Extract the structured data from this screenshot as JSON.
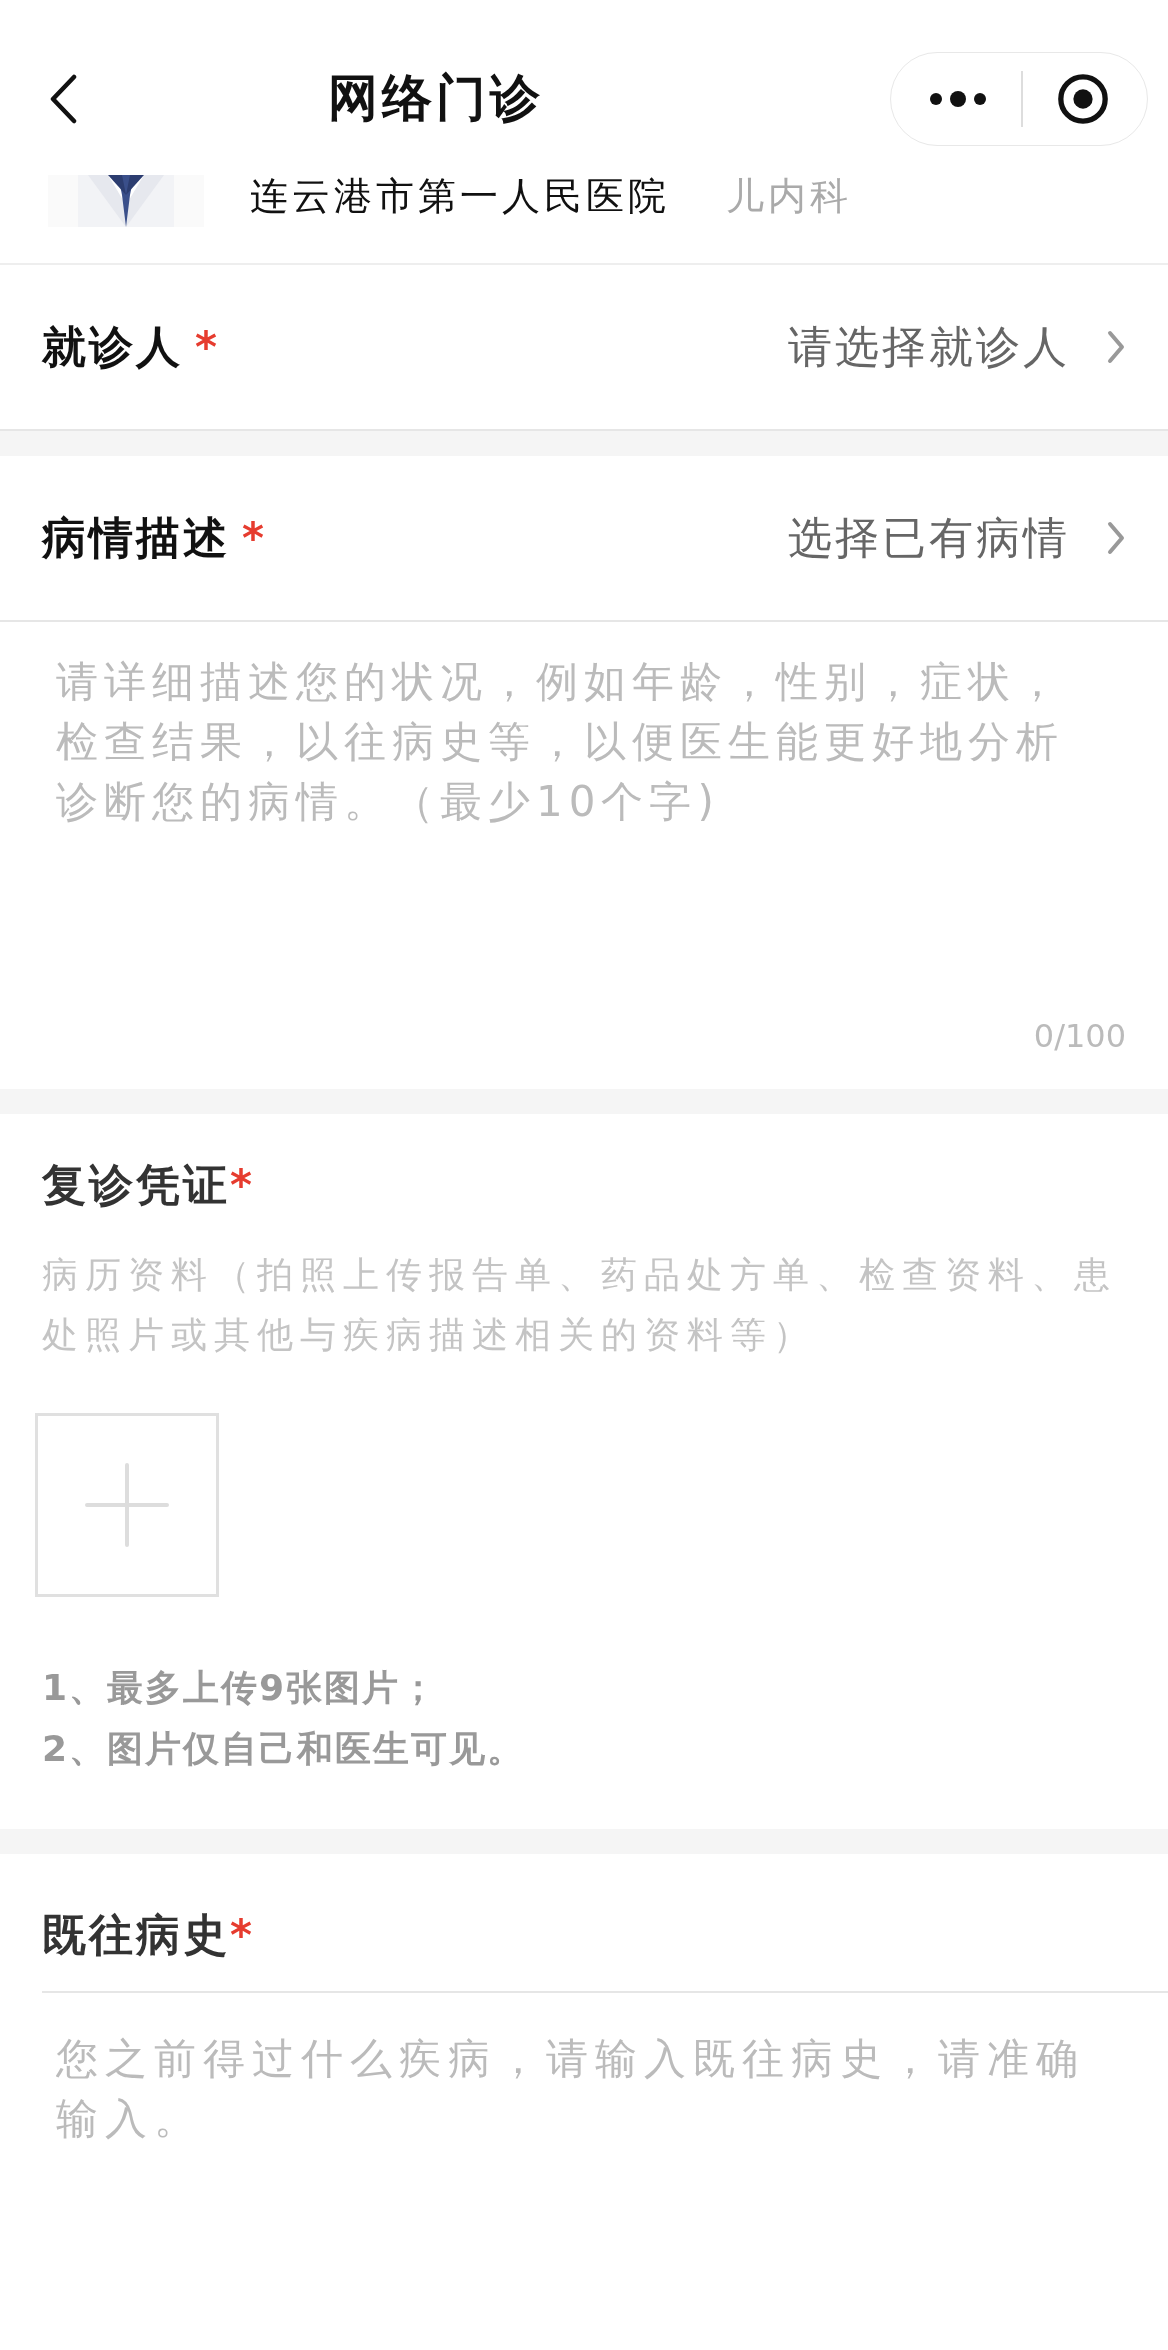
{
  "nav": {
    "title": "网络门诊"
  },
  "doctor": {
    "hospital": "连云港市第一人民医院",
    "department": "儿内科"
  },
  "rows": [
    {
      "label": "就诊人",
      "required_mark": "*",
      "value": "请选择就诊人"
    },
    {
      "label": "病情描述",
      "required_mark": "*",
      "value": "选择已有病情"
    }
  ],
  "description": {
    "placeholder": "请详细描述您的状况，例如年龄，性别，症状，检查结果，以往病史等，以便医生能更好地分析诊断您的病情。（最少10个字)",
    "counter": "0/100"
  },
  "certificate": {
    "title": "复诊凭证",
    "required_mark": "*",
    "hint": "病历资料（拍照上传报告单、药品处方单、检查资料、患处照片或其他与疾病描述相关的资料等）",
    "notes": [
      "1、最多上传9张图片；",
      "2、图片仅自己和医生可见。"
    ]
  },
  "history": {
    "title": "既往病史",
    "required_mark": "*",
    "placeholder": "您之前得过什么疾病，请输入既往病史，请准确输入。"
  }
}
